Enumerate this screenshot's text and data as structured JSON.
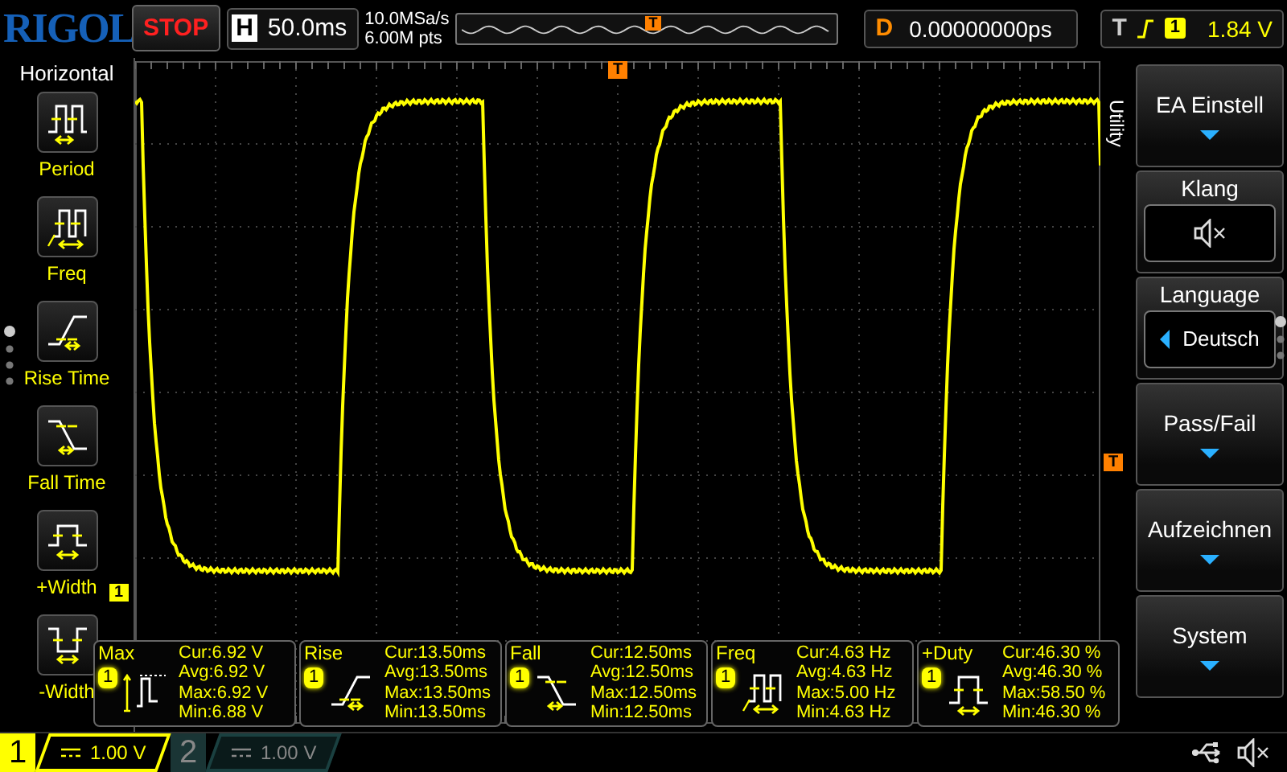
{
  "brand": "RIGOL",
  "run_state": "STOP",
  "horizontal": {
    "label": "H",
    "timebase": "50.0ms"
  },
  "acquisition": {
    "sample_rate": "10.0MSa/s",
    "memory_depth": "6.00M pts",
    "trigger_marker": "T"
  },
  "delay": {
    "label": "D",
    "value": "0.00000000ps"
  },
  "trigger": {
    "label": "T",
    "source": "1",
    "level": "1.84 V"
  },
  "left_menu": {
    "title": "Horizontal",
    "items": [
      {
        "kind": "period",
        "label": "Period"
      },
      {
        "kind": "freq",
        "label": "Freq"
      },
      {
        "kind": "rise",
        "label": "Rise Time"
      },
      {
        "kind": "fall",
        "label": "Fall Time"
      },
      {
        "kind": "pwidth",
        "label": "+Width"
      },
      {
        "kind": "nwidth",
        "label": "-Width"
      }
    ]
  },
  "plot": {
    "trigger_marker_top": "T",
    "trigger_marker_right": "T",
    "channel_marker": "1"
  },
  "right_menu": {
    "title": "Utility",
    "items": [
      {
        "kind": "submenu",
        "label": "EA Einstell"
      },
      {
        "kind": "sound",
        "label": "Klang",
        "muted": true
      },
      {
        "kind": "choice",
        "label": "Language",
        "value": "Deutsch"
      },
      {
        "kind": "submenu",
        "label": "Pass/Fail"
      },
      {
        "kind": "submenu",
        "label": "Aufzeichnen"
      },
      {
        "kind": "submenu",
        "label": "System"
      }
    ]
  },
  "measurements": [
    {
      "kind": "max",
      "name": "Max",
      "channel": "1",
      "readings": [
        "Cur:6.92 V",
        "Avg:6.92 V",
        "Max:6.92 V",
        "Min:6.88 V"
      ]
    },
    {
      "kind": "rise",
      "name": "Rise",
      "channel": "1",
      "readings": [
        "Cur:13.50ms",
        "Avg:13.50ms",
        "Max:13.50ms",
        "Min:13.50ms"
      ]
    },
    {
      "kind": "fall",
      "name": "Fall",
      "channel": "1",
      "readings": [
        "Cur:12.50ms",
        "Avg:12.50ms",
        "Max:12.50ms",
        "Min:12.50ms"
      ]
    },
    {
      "kind": "freq",
      "name": "Freq",
      "channel": "1",
      "readings": [
        "Cur:4.63 Hz",
        "Avg:4.63 Hz",
        "Max:5.00 Hz",
        "Min:4.63 Hz"
      ]
    },
    {
      "kind": "duty",
      "name": "+Duty",
      "channel": "1",
      "readings": [
        "Cur:46.30 %",
        "Avg:46.30 %",
        "Max:58.50 %",
        "Min:46.30 %"
      ]
    }
  ],
  "channels": [
    {
      "number": "1",
      "scale": "1.00 V",
      "on": true
    },
    {
      "number": "2",
      "scale": "1.00 V",
      "on": false
    }
  ]
}
